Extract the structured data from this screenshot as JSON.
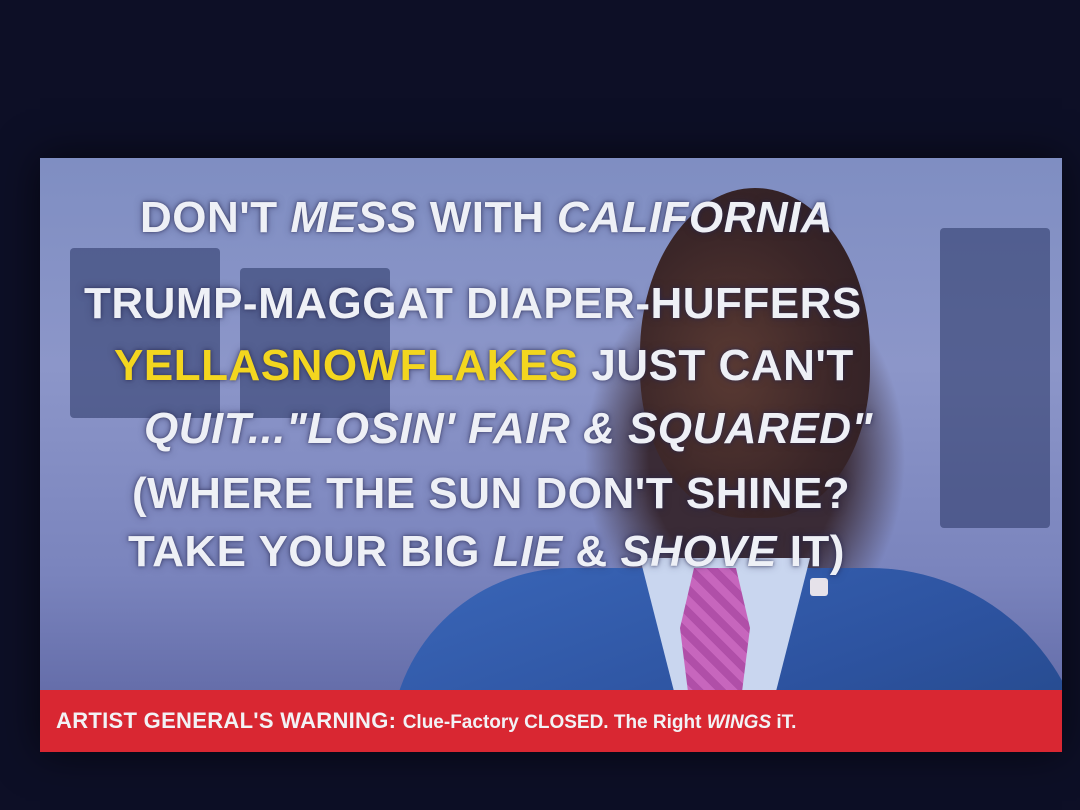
{
  "lines": {
    "l1_a": "DON'T ",
    "l1_b": "MESS",
    "l1_c": " WITH ",
    "l1_d": "CALIFORNIA",
    "l2": "TRUMP-MAGGAT DIAPER-HUFFERS",
    "l3_a": "YELLASNOWFLAKES",
    "l3_b": " JUST CAN'T",
    "l4": "QUIT...\"LOSIN' FAIR & SQUARED\"",
    "l5": "(WHERE THE SUN DON'T SHINE?",
    "l6_a": "TAKE YOUR BIG ",
    "l6_b": "LIE",
    "l6_c": " & ",
    "l6_d": "SHOVE",
    "l6_e": " IT)"
  },
  "warning": {
    "lead": "ARTIST GENERAL'S WARNING: ",
    "a": "Clue-Factory CLOSED. The Right ",
    "b": "WINGS",
    "c": " iT."
  },
  "colors": {
    "banner_red": "#d92732",
    "highlight_yellow": "#f3d61f",
    "text_white": "#eef0f6"
  }
}
